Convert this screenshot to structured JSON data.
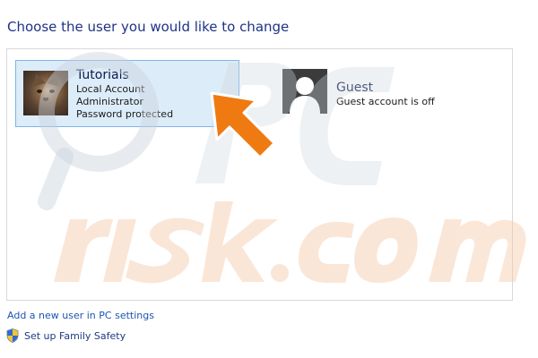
{
  "page": {
    "title": "Choose the user you would like to change"
  },
  "users": [
    {
      "name": "Tutorials",
      "details": [
        "Local Account",
        "Administrator",
        "Password protected"
      ],
      "avatar": "cat-photo",
      "selected": true
    },
    {
      "name": "Guest",
      "details": [
        "Guest account is off"
      ],
      "avatar": "generic-user-icon",
      "selected": false
    }
  ],
  "links": {
    "add_user": "Add a new user in PC settings",
    "family_safety": "Set up Family Safety"
  },
  "icons": {
    "family_safety": "uac-shield-icon",
    "annotation": "orange-pointer-arrow"
  },
  "colors": {
    "title_text": "#1e3287",
    "link_text": "#1a55b5",
    "selected_tile_bg": "#dcecf8",
    "selected_tile_border": "#7eb4ea",
    "annotation_arrow": "#f07a12"
  }
}
